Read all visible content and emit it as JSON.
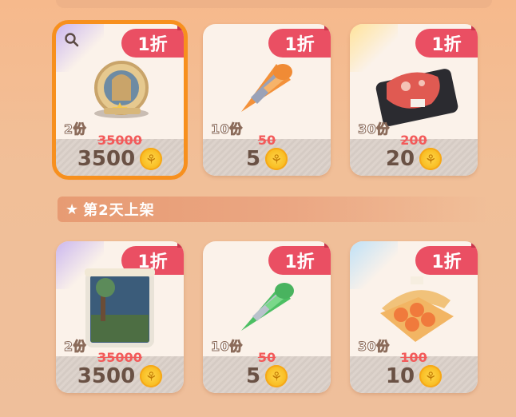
{
  "section": {
    "star_icon": "star-icon",
    "title": "第2天上架"
  },
  "currency_icon": "coin-icon",
  "colors": {
    "discount": "#ea4f63",
    "selected_border": "#f7901e",
    "strike": "#f35a5a"
  },
  "row1": [
    {
      "discount": "1折",
      "quantity": "2份",
      "original_price": "35000",
      "price": "3500",
      "item_icon": "hamster-wheel-icon",
      "selected": true
    },
    {
      "discount": "1折",
      "quantity": "10份",
      "original_price": "50",
      "price": "5",
      "item_icon": "orange-cone-candy-icon"
    },
    {
      "discount": "1折",
      "quantity": "30份",
      "original_price": "200",
      "price": "20",
      "item_icon": "meat-tray-icon"
    }
  ],
  "row2": [
    {
      "discount": "1折",
      "quantity": "2份",
      "original_price": "35000",
      "price": "3500",
      "item_icon": "aquarium-tank-icon"
    },
    {
      "discount": "1折",
      "quantity": "10份",
      "original_price": "50",
      "price": "5",
      "item_icon": "green-cone-candy-icon"
    },
    {
      "discount": "1折",
      "quantity": "30份",
      "original_price": "100",
      "price": "10",
      "item_icon": "egg-carton-icon"
    }
  ]
}
